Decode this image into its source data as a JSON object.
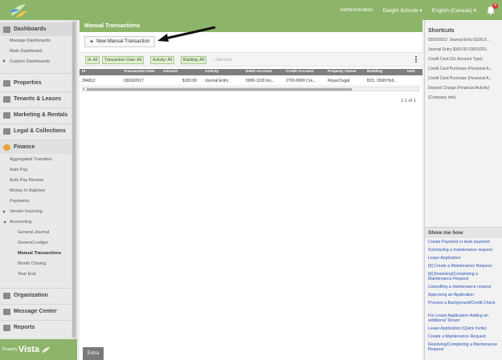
{
  "topbar": {
    "admin_label": "Administration",
    "user_label": "Dwight Schrute ▾",
    "language_label": "English (Canada) ▾",
    "notification_count": "4"
  },
  "sidebar": {
    "sections": {
      "dashboards": "Dashboards",
      "properties": "Properties",
      "tenants": "Tenants & Leases",
      "marketing": "Marketing & Rentals",
      "legal": "Legal & Collections",
      "finance": "Finance",
      "organization": "Organization",
      "message_center": "Message Center",
      "reports": "Reports"
    },
    "dashboards_items": [
      "Manage Dashboards",
      "Main Dashboard",
      "Custom Dashboards"
    ],
    "finance_items": [
      "Aggregated Transfers",
      "Auto Pay",
      "Auto Pay Review",
      "Money In Batches",
      "Payments",
      "Vendor Invoicing",
      "Accounting"
    ],
    "accounting_items": [
      "General Journal",
      "General Ledger",
      "Manual Transactions",
      "Month Closing",
      "Year End"
    ],
    "brand": {
      "small": "Property",
      "big": "Vista"
    }
  },
  "main": {
    "title": "Manual Transactions",
    "new_button_label": "New Manual Transaction",
    "filters": [
      "Id: All",
      "Transaction Date: All",
      "Activity: All",
      "Building: All"
    ],
    "add_item_label": "+ Add Item",
    "columns": [
      "Id",
      "Transaction Date",
      "Amount",
      "Activity",
      "Debit Account",
      "Credit Account",
      "Property Owner",
      "Building",
      "Unit"
    ],
    "rows": [
      [
        "394812",
        "03/03/2017",
        "$100.00",
        "Journal Entry",
        "5000-1100 Ins...",
        "2700-0000 Cre...",
        "Royal Dugal",
        "B15, 1568 Holl...",
        ""
      ]
    ],
    "pager": "1-1 of 1",
    "extra_tab": "Extra"
  },
  "right": {
    "shortcuts_title": "Shortcuts",
    "shortcuts": [
      "03/03/2017 Journal Entry $100.0...",
      "Journal Entry $100.00 03/03/201...",
      "Credit Card (GL Account Type)",
      "Credit Card Purchase (Financial A...",
      "Credit Card Purchase (Financial A...",
      "Deposit Charge (Financial Activity)",
      "(Company Info)"
    ],
    "show_me_title": "Show me how",
    "how_to": [
      "Create Payment or Auto payment",
      "Scheduling a maintenance request",
      "Lease Application",
      "[d] Create a Maintenance Request",
      "[d] Resolving/Completing a Maintenance Request",
      "Cancelling a maintenance request",
      "Approving an Application",
      "Process a Background/Credit Check",
      "For Lease Application-Adding an additional Tenant",
      "Lease Application (Quick Invite)",
      "Create a Maintenance Request",
      "Resolving/Completing a Maintenance Request"
    ]
  },
  "colors": {
    "brand_green": "#8db56a",
    "link_blue": "#2d55b8",
    "finance_orange": "#e8a13a",
    "badge_red": "#dd3333"
  }
}
